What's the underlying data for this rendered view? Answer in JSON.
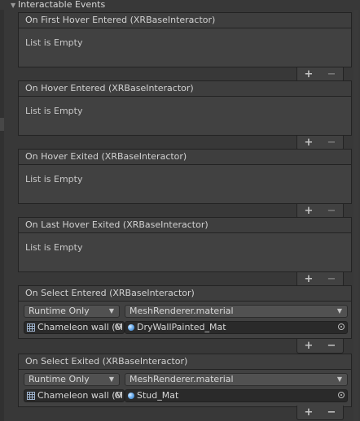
{
  "section": {
    "title": "Interactable Events",
    "arrow_icon": "triangle-down-icon"
  },
  "empty_events": [
    {
      "header": "On First Hover Entered (XRBaseInteractor)",
      "empty_text": "List is Empty"
    },
    {
      "header": "On Hover Entered (XRBaseInteractor)",
      "empty_text": "List is Empty"
    },
    {
      "header": "On Hover Exited (XRBaseInteractor)",
      "empty_text": "List is Empty"
    },
    {
      "header": "On Last Hover Exited (XRBaseInteractor)",
      "empty_text": "List is Empty"
    }
  ],
  "filled_events": [
    {
      "header": "On Select Entered (XRBaseInteractor)",
      "call_state": "Runtime Only",
      "function": "MeshRenderer.material",
      "target_object": "Chameleon wall (M",
      "argument": "DryWallPainted_Mat"
    },
    {
      "header": "On Select Exited (XRBaseInteractor)",
      "call_state": "Runtime Only",
      "function": "MeshRenderer.material",
      "target_object": "Chameleon wall (M",
      "argument": "Stud_Mat"
    }
  ],
  "buttons": {
    "plus": "+",
    "minus": "−"
  }
}
